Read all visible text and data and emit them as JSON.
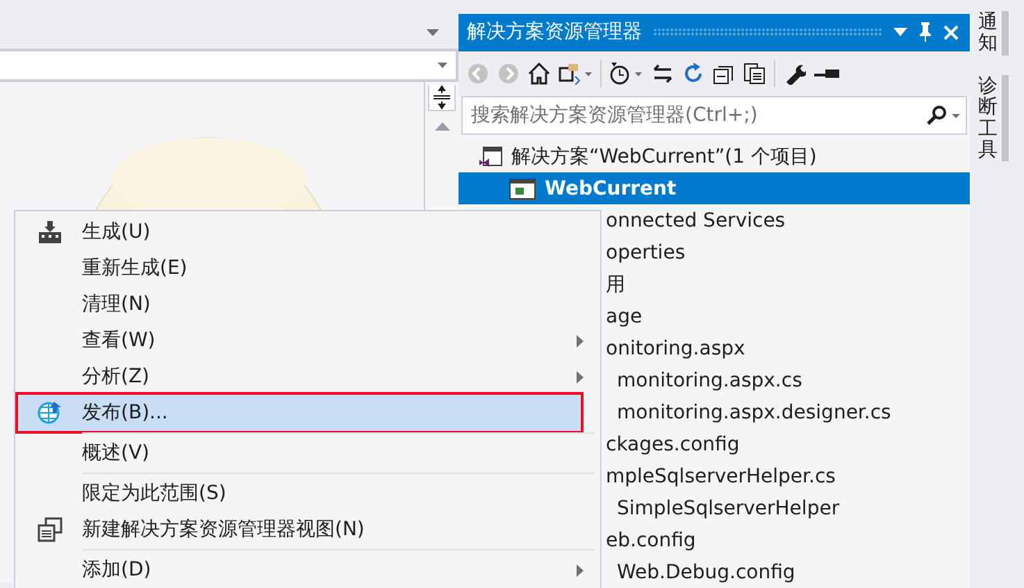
{
  "solution_explorer": {
    "title": "解决方案资源管理器",
    "search": {
      "placeholder": "搜索解决方案资源管理器(Ctrl+;)"
    },
    "tree": [
      {
        "label": "解决方案“WebCurrent”(1 个项目)",
        "selected": false,
        "children": [
          {
            "label": "WebCurrent",
            "selected": true,
            "children": [
              {
                "label": "onnected Services",
                "selected": false
              },
              {
                "label": "operties",
                "selected": false
              },
              {
                "label": "用",
                "selected": false
              },
              {
                "label": "age",
                "selected": false
              },
              {
                "label": "onitoring.aspx",
                "selected": false,
                "children": [
                  {
                    "label": "monitoring.aspx.cs",
                    "selected": false
                  },
                  {
                    "label": "monitoring.aspx.designer.cs",
                    "selected": false
                  }
                ]
              },
              {
                "label": "ckages.config",
                "selected": false
              },
              {
                "label": "mpleSqlserverHelper.cs",
                "selected": false,
                "children": [
                  {
                    "label": "SimpleSqlserverHelper",
                    "selected": false
                  }
                ]
              },
              {
                "label": "eb.config",
                "selected": false,
                "children": [
                  {
                    "label": "Web.Debug.config",
                    "selected": false
                  }
                ]
              }
            ]
          }
        ]
      }
    ]
  },
  "context_menu": [
    {
      "kind": "build",
      "label": "生成(U)",
      "submenu": false,
      "selected": false,
      "annotated": false
    },
    {
      "kind": "text",
      "label": "重新生成(E)",
      "submenu": false,
      "selected": false,
      "annotated": false
    },
    {
      "kind": "text",
      "label": "清理(N)",
      "submenu": false,
      "selected": false,
      "annotated": false
    },
    {
      "kind": "text",
      "label": "查看(W)",
      "submenu": true,
      "selected": false,
      "annotated": false
    },
    {
      "kind": "text",
      "label": "分析(Z)",
      "submenu": true,
      "selected": false,
      "annotated": false
    },
    {
      "kind": "publish",
      "label": "发布(B)...",
      "submenu": false,
      "selected": true,
      "annotated": true
    },
    {
      "kind": "separator"
    },
    {
      "kind": "text",
      "label": "概述(V)",
      "submenu": false,
      "selected": false,
      "annotated": false
    },
    {
      "kind": "separator"
    },
    {
      "kind": "text",
      "label": "限定为此范围(S)",
      "submenu": false,
      "selected": false,
      "annotated": false
    },
    {
      "kind": "newview",
      "label": "新建解决方案资源管理器视图(N)",
      "submenu": false,
      "selected": false,
      "annotated": false
    },
    {
      "kind": "separator"
    },
    {
      "kind": "text",
      "label": "添加(D)",
      "submenu": true,
      "selected": false,
      "annotated": false
    }
  ],
  "side_tabs": [
    {
      "label": "通知"
    },
    {
      "label": "诊断工具"
    }
  ]
}
